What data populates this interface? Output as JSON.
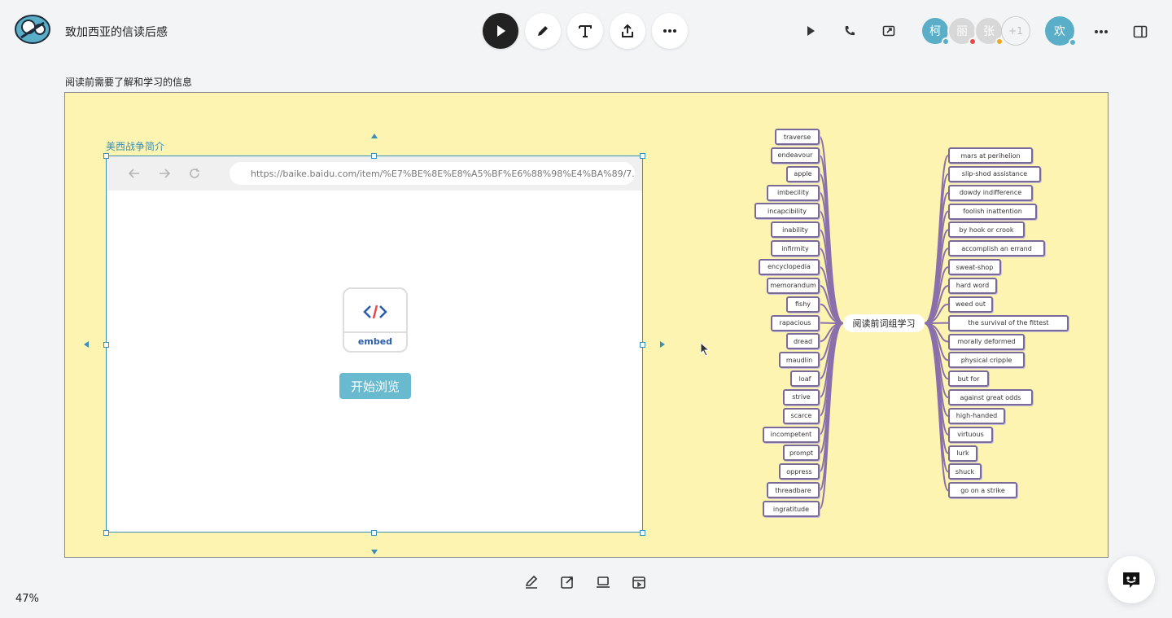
{
  "header": {
    "title": "致加西亚的信读后感",
    "tools": [
      {
        "name": "select-tool",
        "icon": "pointer-icon",
        "active": true
      },
      {
        "name": "pen-tool",
        "icon": "pencil-icon"
      },
      {
        "name": "text-tool",
        "icon": "text-icon"
      },
      {
        "name": "upload-tool",
        "icon": "upload-icon"
      },
      {
        "name": "more-tool",
        "icon": "more-icon"
      }
    ],
    "right_icons": [
      "play-icon",
      "phone-icon",
      "share-screen-icon"
    ],
    "avatars": [
      {
        "initial": "柯",
        "color": "#5aaec7",
        "status": "#5aaec7"
      },
      {
        "initial": "丽",
        "color": "#d8d8d8",
        "status": "#e24b4b"
      },
      {
        "initial": "张",
        "color": "#d8d8d8",
        "status": "#f0a820"
      }
    ],
    "more_count": "+1",
    "me": "欢"
  },
  "frame": {
    "title": "阅读前需要了解和学习的信息",
    "bg": "#fef4b2"
  },
  "embed": {
    "label": "美西战争简介",
    "url": "https://baike.baidu.com/item/%E7%BE%8E%E8%A5%BF%E6%88%98%E4%BA%89/7...",
    "card_label": "embed",
    "start_button": "开始浏览",
    "accent": "#3a8fb7"
  },
  "mindmap": {
    "center": "阅读前词组学习",
    "left": [
      "traverse",
      "endeavour",
      "apple",
      "imbecility",
      "incapcibility",
      "inability",
      "infirmity",
      "encyclopedia",
      "memorandum",
      "fishy",
      "rapacious",
      "dread",
      "maudlin",
      "loaf",
      "strive",
      "scarce",
      "incompetent",
      "prompt",
      "oppress",
      "threadbare",
      "ingratitude"
    ],
    "right": [
      "mars at perihelion",
      "slip-shod assistance",
      "dowdy indifference",
      "foolish inattention",
      "by hook or crook",
      "accomplish  an errand",
      "sweat-shop",
      "hard word",
      "weed out",
      "the survival of the fittest",
      "morally deformed",
      "physical cripple",
      "but for",
      "against great odds",
      "high-handed",
      "virtuous",
      "lurk",
      "shuck",
      "go on a strike"
    ],
    "line_color": "#8a70aa"
  },
  "bottom": {
    "icons": [
      "edit-icon",
      "open-external-icon",
      "present-icon",
      "archive-icon"
    ],
    "zoom": "47%"
  }
}
